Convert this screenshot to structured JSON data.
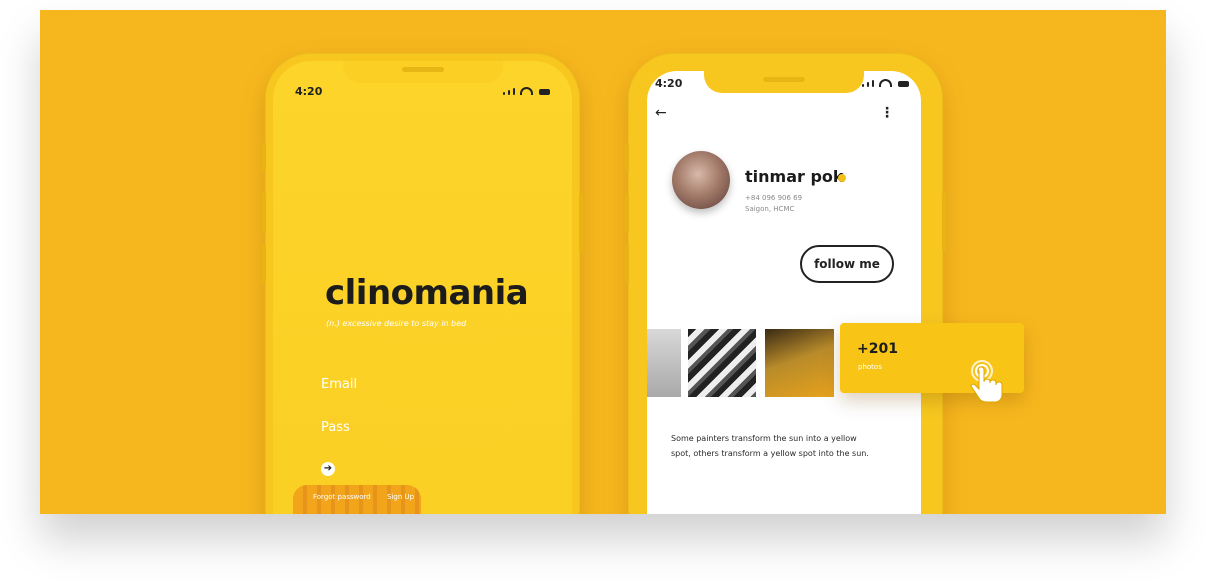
{
  "left_screen": {
    "status_time": "4:20",
    "brand": "clinomania",
    "tagline": "(n.) excessive desire to stay in bed",
    "email_label": "Email",
    "pass_label": "Pass",
    "forgot_label": "Forgot password",
    "signup_label": "Sign Up"
  },
  "right_screen": {
    "status_time": "4:20",
    "profile": {
      "name": "tinmar pok",
      "phone": "+84 096 906 69",
      "location": "Saigon, HCMC"
    },
    "follow_label": "follow me",
    "photos_count": "+201",
    "photos_label": "photos",
    "quote": "Some painters transform the sun into a yellow spot, others transform a yellow spot into the sun."
  },
  "colors": {
    "background": "#F6B71E",
    "phone": "#F7C71F",
    "accent": "#F8C416"
  }
}
